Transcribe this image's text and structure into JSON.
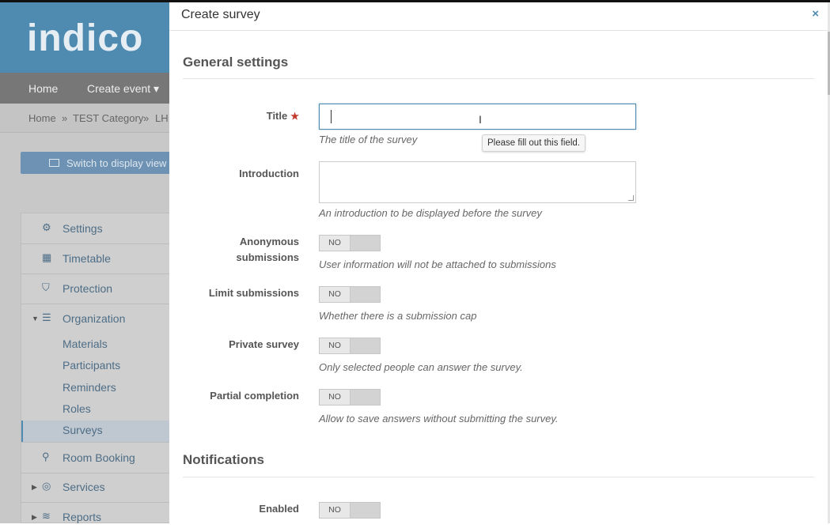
{
  "app": {
    "logo_text": "indico",
    "nav": {
      "home": "Home",
      "create_event": "Create event ▾"
    },
    "breadcrumb": {
      "home": "Home",
      "sep1": "»",
      "category": "TEST Category",
      "sep2": "»",
      "event": "LH"
    },
    "switch_button": "Switch to display view",
    "menu": {
      "settings": "Settings",
      "timetable": "Timetable",
      "protection": "Protection",
      "organization": "Organization",
      "materials": "Materials",
      "participants": "Participants",
      "reminders": "Reminders",
      "roles": "Roles",
      "surveys": "Surveys",
      "room_booking": "Room Booking",
      "services": "Services",
      "reports": "Reports"
    }
  },
  "modal": {
    "title": "Create survey",
    "close": "×",
    "general_heading": "General settings",
    "title_field": {
      "label": "Title",
      "required": "★",
      "value": "",
      "help": "The title of the survey",
      "validation_tooltip": "Please fill out this field."
    },
    "intro_field": {
      "label": "Introduction",
      "value": "",
      "help": "An introduction to be displayed before the survey"
    },
    "anonymous": {
      "label_line1": "Anonymous",
      "label_line2": "submissions",
      "state": "NO",
      "help": "User information will not be attached to submissions"
    },
    "limit": {
      "label": "Limit submissions",
      "state": "NO",
      "help": "Whether there is a submission cap"
    },
    "private": {
      "label": "Private survey",
      "state": "NO",
      "help": "Only selected people can answer the survey."
    },
    "partial": {
      "label": "Partial completion",
      "state": "NO",
      "help": "Allow to save answers without submitting the survey."
    },
    "notifications_heading": "Notifications",
    "enabled": {
      "label": "Enabled",
      "state": "NO"
    }
  },
  "colors": {
    "brand": "#4f8bb0",
    "required": "#c0392b"
  }
}
